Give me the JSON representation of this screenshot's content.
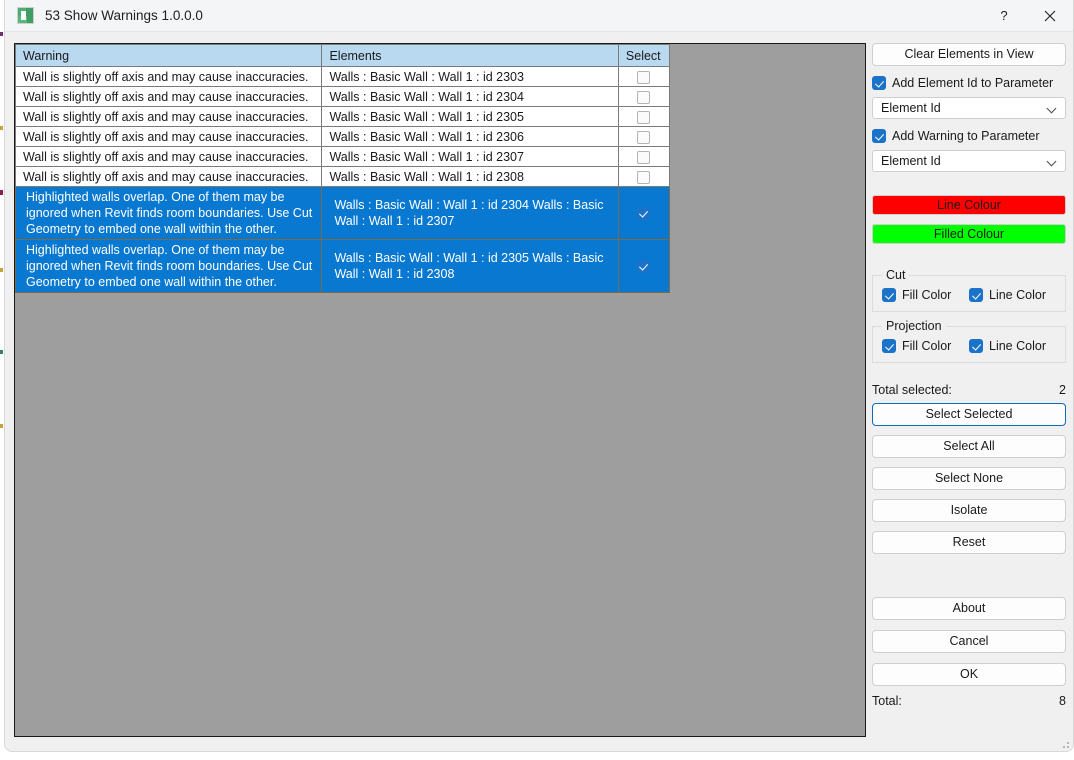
{
  "window": {
    "title": "53 Show Warnings 1.0.0.0",
    "icon": "revit-addin-icon",
    "help_button": "?",
    "close_button": "✕"
  },
  "table": {
    "columns": [
      "Warning",
      "Elements",
      "Select"
    ],
    "rows": [
      {
        "warning": "Wall is slightly off axis and may cause inaccuracies.",
        "elements": "Walls : Basic Wall : Wall 1 : id 2303",
        "selected": false,
        "checked": false
      },
      {
        "warning": "Wall is slightly off axis and may cause inaccuracies.",
        "elements": "Walls : Basic Wall : Wall 1 : id 2304",
        "selected": false,
        "checked": false
      },
      {
        "warning": "Wall is slightly off axis and may cause inaccuracies.",
        "elements": "Walls : Basic Wall : Wall 1 : id 2305",
        "selected": false,
        "checked": false
      },
      {
        "warning": "Wall is slightly off axis and may cause inaccuracies.",
        "elements": "Walls : Basic Wall : Wall 1 : id 2306",
        "selected": false,
        "checked": false
      },
      {
        "warning": "Wall is slightly off axis and may cause inaccuracies.",
        "elements": "Walls : Basic Wall : Wall 1 : id 2307",
        "selected": false,
        "checked": false
      },
      {
        "warning": "Wall is slightly off axis and may cause inaccuracies.",
        "elements": "Walls : Basic Wall : Wall 1 : id 2308",
        "selected": false,
        "checked": false
      },
      {
        "warning": "Highlighted walls overlap. One of them may be ignored when Revit finds room boundaries. Use Cut Geometry to embed one wall within the other.",
        "elements": "Walls : Basic Wall : Wall 1 : id 2304    Walls : Basic Wall : Wall 1 : id 2307",
        "selected": true,
        "checked": true
      },
      {
        "warning": "Highlighted walls overlap. One of them may be ignored when Revit finds room boundaries. Use Cut Geometry to embed one wall within the other.",
        "elements": "Walls : Basic Wall : Wall 1 : id 2305    Walls : Basic Wall : Wall 1 : id 2308",
        "selected": true,
        "checked": true
      }
    ]
  },
  "panel": {
    "clear_elements_button": "Clear Elements in View",
    "add_element_id_checkbox": "Add Element Id to Parameter",
    "element_id_param_select": "Element Id",
    "add_warning_checkbox": "Add Warning to Parameter",
    "warning_param_select": "Element Id",
    "line_colour_button": "Line Colour",
    "filled_colour_button": "Filled Colour",
    "line_colour_hex": "#ff0000",
    "filled_colour_hex": "#00ff00",
    "cut_group_label": "Cut",
    "cut_fill_color": "Fill Color",
    "cut_line_color": "Line Color",
    "projection_group_label": "Projection",
    "projection_fill_color": "Fill Color",
    "projection_line_color": "Line Color",
    "total_selected_label": "Total selected:",
    "total_selected_value": "2",
    "select_selected_button": "Select Selected",
    "select_all_button": "Select All",
    "select_none_button": "Select None",
    "isolate_button": "Isolate",
    "reset_button": "Reset",
    "about_button": "About",
    "cancel_button": "Cancel",
    "ok_button": "OK",
    "total_label": "Total:",
    "total_value": "8"
  }
}
